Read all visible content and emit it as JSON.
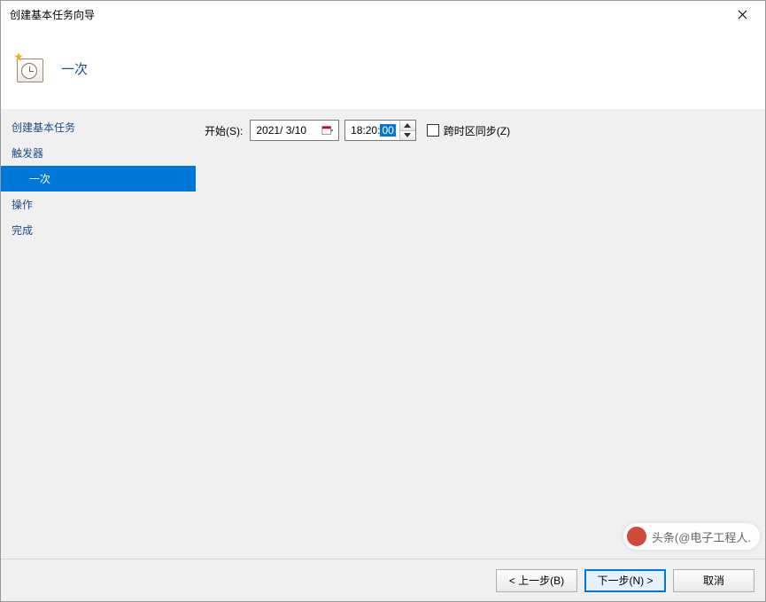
{
  "window": {
    "title": "创建基本任务向导"
  },
  "header": {
    "heading": "一次"
  },
  "sidebar": {
    "items": [
      {
        "label": "创建基本任务",
        "indent": false,
        "selected": false
      },
      {
        "label": "触发器",
        "indent": false,
        "selected": false
      },
      {
        "label": "一次",
        "indent": true,
        "selected": true
      },
      {
        "label": "操作",
        "indent": false,
        "selected": false
      },
      {
        "label": "完成",
        "indent": false,
        "selected": false
      }
    ]
  },
  "form": {
    "start_label": "开始(S):",
    "date_value": "2021/ 3/10",
    "time_hour_min": "18:20:",
    "time_seconds_selected": "00",
    "tz_sync_label": "跨时区同步(Z)",
    "tz_sync_checked": false
  },
  "footer": {
    "back": "<  上一步(B)",
    "next": "下一步(N)  >",
    "cancel": "取消"
  },
  "watermark": {
    "text": "头条(@电子工程人."
  }
}
